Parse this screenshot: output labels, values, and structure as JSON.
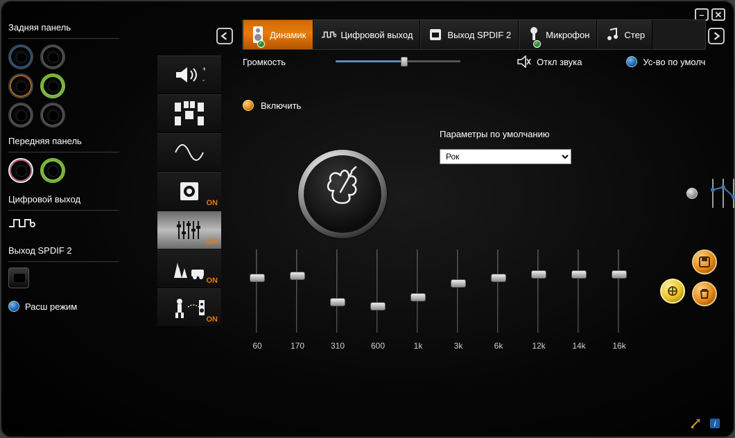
{
  "jacks": {
    "rear_title": "Задняя панель",
    "front_title": "Передняя панель",
    "digital_out": "Цифровой выход",
    "spdif2": "Выход SPDIF 2",
    "adv_mode": "Расш режим"
  },
  "tabs": [
    {
      "label": "Динамик",
      "icon": "speaker"
    },
    {
      "label": "Цифровой выход",
      "icon": "digital"
    },
    {
      "label": "Выход SPDIF 2",
      "icon": "spdif"
    },
    {
      "label": "Микрофон",
      "icon": "mic"
    },
    {
      "label": "Стер",
      "icon": "music"
    }
  ],
  "sidecat": [
    {
      "on": ""
    },
    {
      "on": ""
    },
    {
      "on": ""
    },
    {
      "on": "ON"
    },
    {
      "on": "ON"
    },
    {
      "on": "ON"
    },
    {
      "on": "ON"
    }
  ],
  "row1": {
    "volume_label": "Громкость",
    "volume_pct": 55,
    "mute_label": "Откл звука",
    "default_label": "Ус-во по умолч"
  },
  "enable_label": "Включить",
  "params_title": "Параметры по умолчанию",
  "preset_selected": "Рок",
  "eq": {
    "bands": [
      "60",
      "170",
      "310",
      "600",
      "1k",
      "3k",
      "6k",
      "12k",
      "14k",
      "16k"
    ],
    "values_pct": [
      68,
      70,
      35,
      30,
      42,
      60,
      68,
      72,
      72,
      72
    ]
  }
}
